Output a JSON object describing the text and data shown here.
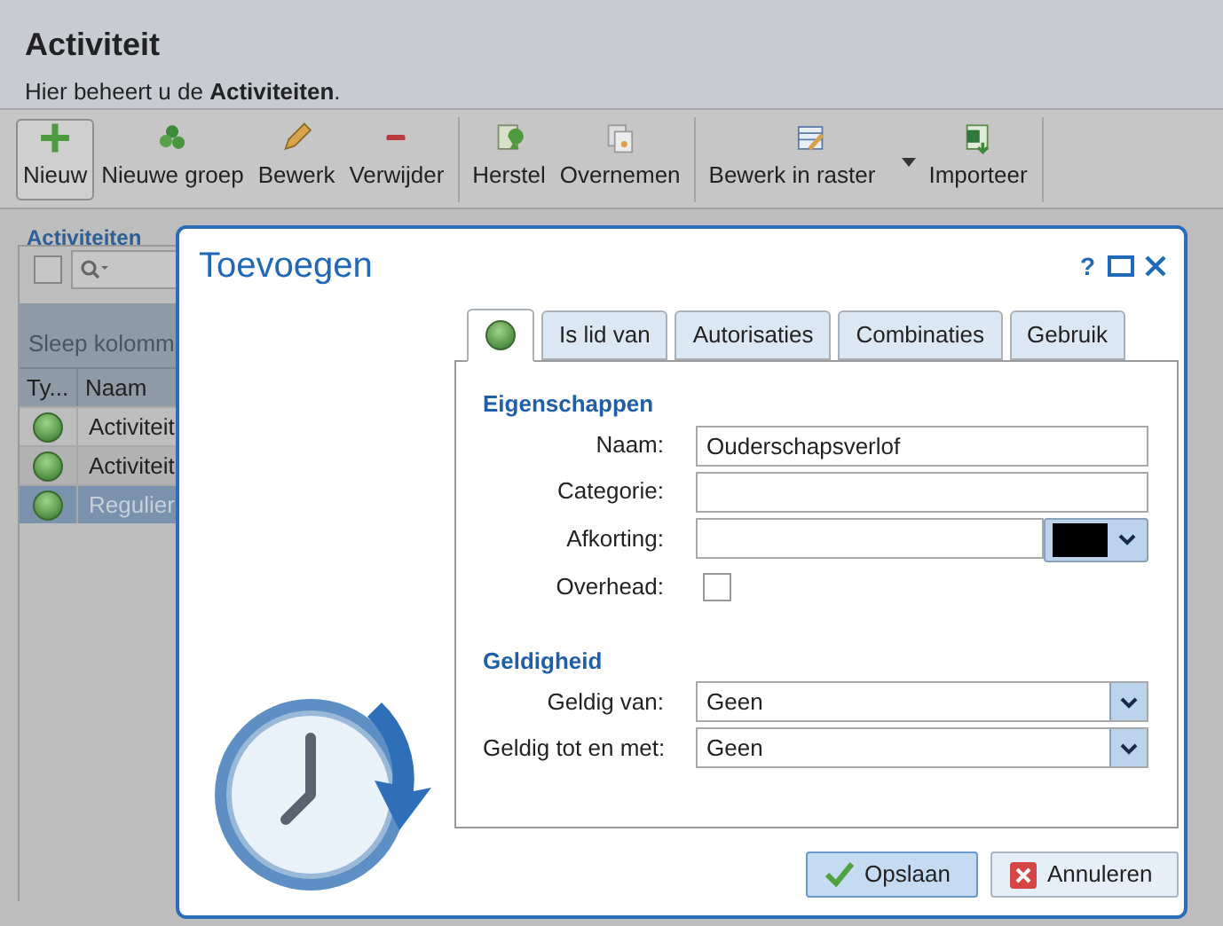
{
  "header": {
    "title": "Activiteit",
    "subtitle": "Hier beheert u de **Activiteiten**."
  },
  "toolbar": {
    "groups": [
      [
        {
          "label": "Nieuw",
          "selected": true,
          "has_menu": false
        },
        {
          "label": "Nieuwe groep",
          "selected": false,
          "has_menu": false
        },
        {
          "label": "Bewerk",
          "selected": false,
          "has_menu": false
        },
        {
          "label": "Verwijder",
          "selected": false,
          "has_menu": false
        }
      ],
      [
        {
          "label": "Herstel",
          "selected": false,
          "has_menu": false
        },
        {
          "label": "Overnemen",
          "selected": false,
          "has_menu": false
        }
      ],
      [
        {
          "label": "Bewerk in raster",
          "selected": false,
          "has_menu": true
        },
        {
          "label": "Importeer",
          "selected": false,
          "has_menu": false
        }
      ]
    ]
  },
  "panel": {
    "title": "Activiteiten",
    "select_all_checked": false,
    "group_hint": "Sleep kolomm",
    "columns": [
      "Ty...",
      "Naam"
    ],
    "rows": [
      {
        "name": "Activiteit",
        "selected": false
      },
      {
        "name": "Activiteit",
        "selected": false
      },
      {
        "name": "Regulier",
        "selected": true
      }
    ]
  },
  "dialog": {
    "title": "Toevoegen",
    "controls": [
      "?"
    ],
    "tabs": [
      {
        "kind": "icon",
        "selected": true
      },
      {
        "kind": "text",
        "label": "Is lid van",
        "selected": false
      },
      {
        "kind": "text",
        "label": "Autorisaties",
        "selected": false
      },
      {
        "kind": "text",
        "label": "Combinaties",
        "selected": false
      },
      {
        "kind": "text",
        "label": "Gebruik",
        "selected": false
      }
    ],
    "sections": [
      {
        "title": "Eigenschappen",
        "fields": [
          {
            "label": "Naam:",
            "kind": "text",
            "value": "Ouderschapsverlof"
          },
          {
            "label": "Categorie:",
            "kind": "text"
          },
          {
            "label": "Afkorting:",
            "kind": "color",
            "color": "#000000"
          },
          {
            "label": "Overhead:",
            "kind": "checkbox",
            "checked": false
          }
        ]
      },
      {
        "title": "Geldigheid",
        "fields": [
          {
            "label": "Geldig van:",
            "kind": "select",
            "value": "Geen"
          },
          {
            "label": "Geldig tot en met:",
            "kind": "select",
            "value": "Geen"
          }
        ]
      }
    ],
    "buttons": [
      {
        "label": "Opslaan",
        "kind": "confirm"
      },
      {
        "label": "Annuleren",
        "kind": "cancel"
      }
    ]
  }
}
